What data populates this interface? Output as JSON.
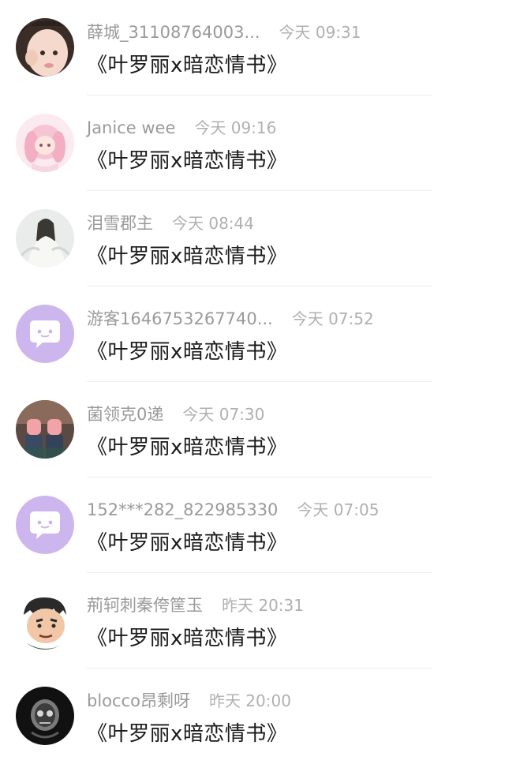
{
  "messages": [
    {
      "name": "薛城_31108764003...",
      "time": "今天 09:31",
      "text": "《叶罗丽x暗恋情书》",
      "avatar_icon": "avatar-baby-photo-icon"
    },
    {
      "name": "Janice wee",
      "time": "今天 09:16",
      "text": "《叶罗丽x暗恋情书》",
      "avatar_icon": "avatar-pink-anime-girl-icon"
    },
    {
      "name": "泪雪郡主",
      "time": "今天 08:44",
      "text": "《叶罗丽x暗恋情书》",
      "avatar_icon": "avatar-white-anime-girl-icon"
    },
    {
      "name": "游客1646753267740...",
      "time": "今天 07:52",
      "text": "《叶罗丽x暗恋情书》",
      "avatar_icon": "avatar-default-chat-bubble-icon"
    },
    {
      "name": "菌领克0递",
      "time": "今天 07:30",
      "text": "《叶罗丽x暗恋情书》",
      "avatar_icon": "avatar-sneakers-photo-icon"
    },
    {
      "name": "152***282_822985330",
      "time": "今天 07:05",
      "text": "《叶罗丽x暗恋情书》",
      "avatar_icon": "avatar-default-chat-bubble-icon"
    },
    {
      "name": "荊轲刺秦侉筐玉",
      "time": "昨天 20:31",
      "text": "《叶罗丽x暗恋情书》",
      "avatar_icon": "avatar-cartoon-face-icon"
    },
    {
      "name": "blocco昂剩呀",
      "time": "昨天 20:00",
      "text": "《叶罗丽x暗恋情书》",
      "avatar_icon": "avatar-dark-skull-icon"
    }
  ],
  "colors": {
    "default_avatar_bg": "#cdb6ee",
    "name_text": "#9a9a9a",
    "time_text": "#b0b0b0",
    "message_text": "#1a1a1a",
    "divider": "#eeeeee"
  }
}
